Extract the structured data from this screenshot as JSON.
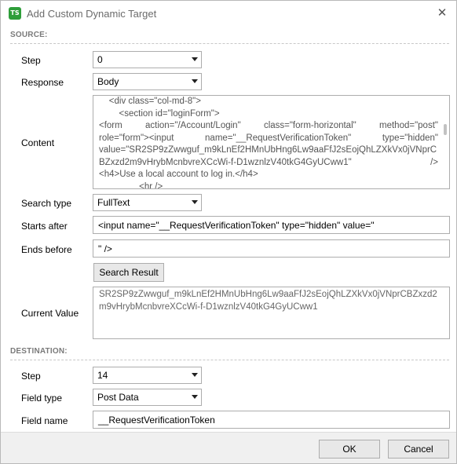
{
  "window": {
    "title": "Add Custom Dynamic Target",
    "icon_text": "TS",
    "close_glyph": "✕"
  },
  "source": {
    "header": "SOURCE:",
    "step": {
      "label": "Step",
      "value": "0"
    },
    "response": {
      "label": "Response",
      "value": "Body"
    },
    "content": {
      "label": "Content",
      "lines": [
        "    <div class=\"col-md-8\">",
        "        <section id=\"loginForm\">",
        "<h4>Use a local account to log in.</h4>",
        "                <hr />"
      ],
      "justified_lines": [
        [
          "<form",
          "action=\"/Account/Login\"",
          "class=\"form-horizontal\"",
          "method=\"post\""
        ],
        [
          "role=\"form\"><input",
          "name=\"__RequestVerificationToken\"",
          "type=\"hidden\""
        ],
        [
          "value=\"SR2SP9zZwwguf_m9kLnEf2HMnUbHng6Lw9aaFfJ2sEojQhLZXkVx0jVNprC"
        ],
        [
          "BZxzd2m9vHrybMcnbvreXCcWi-f-D1wznlzV40tkG4GyUCww1\"",
          "/>"
        ]
      ]
    },
    "search_type": {
      "label": "Search type",
      "value": "FullText"
    },
    "starts_after": {
      "label": "Starts after",
      "value": "<input name=\"__RequestVerificationToken\" type=\"hidden\" value=\""
    },
    "ends_before": {
      "label": "Ends before",
      "value": "\" />"
    },
    "search_result_button": "Search Result",
    "current_value": {
      "label": "Current Value",
      "value": "SR2SP9zZwwguf_m9kLnEf2HMnUbHng6Lw9aaFfJ2sEojQhLZXkVx0jVNprCBZxzd2m9vHrybMcnbvreXCcWi-f-D1wznlzV40tkG4GyUCww1"
    }
  },
  "destination": {
    "header": "DESTINATION:",
    "step": {
      "label": "Step",
      "value": "14"
    },
    "field_type": {
      "label": "Field type",
      "value": "Post Data"
    },
    "field_name": {
      "label": "Field name",
      "value": "__RequestVerificationToken"
    }
  },
  "footer": {
    "ok_label": "OK",
    "cancel_label": "Cancel"
  },
  "colors": {
    "app_icon": "#2e9e3a",
    "section_header": "#7a7a7a"
  }
}
